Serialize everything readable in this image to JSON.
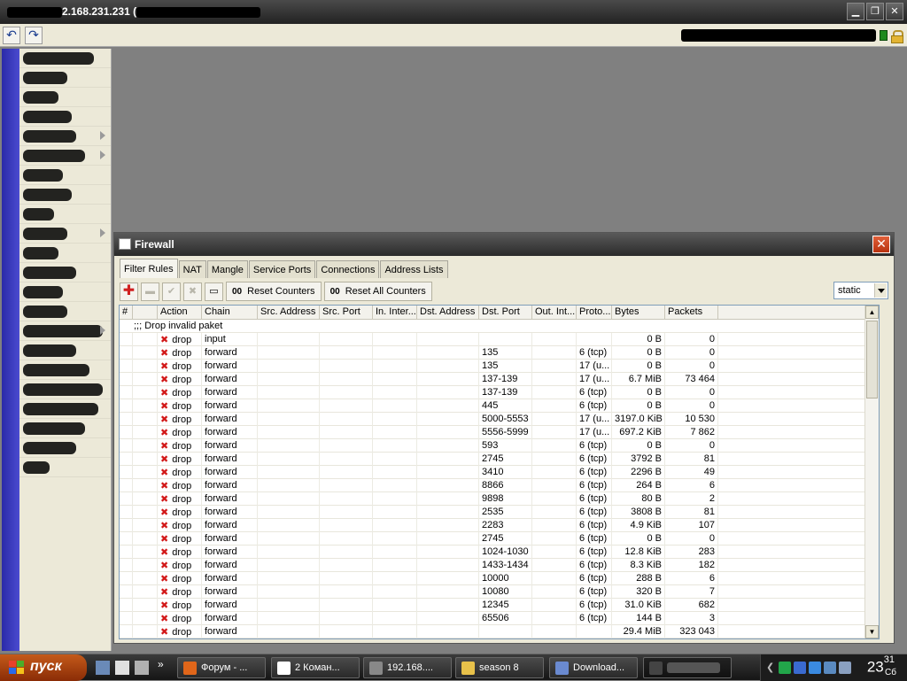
{
  "app": {
    "title_visible": "2.168.231.231 ("
  },
  "firewall": {
    "window_title": "Firewall",
    "tabs": [
      "Filter Rules",
      "NAT",
      "Mangle",
      "Service Ports",
      "Connections",
      "Address Lists"
    ],
    "active_tab": "Filter Rules",
    "reset_counters_label": "Reset Counters",
    "reset_all_counters_label": "Reset All Counters",
    "reset_prefix": "00",
    "filter_value": "static",
    "columns": [
      "#",
      "",
      "Action",
      "Chain",
      "Src. Address",
      "Src. Port",
      "In. Inter...",
      "Dst. Address",
      "Dst. Port",
      "Out. Int...",
      "Proto...",
      "Bytes",
      "Packets"
    ],
    "comment": ";;; Drop invalid paket",
    "rows": [
      {
        "action": "drop",
        "chain": "input",
        "dst_port": "",
        "proto": "",
        "bytes": "0 B",
        "packets": "0"
      },
      {
        "action": "drop",
        "chain": "forward",
        "dst_port": "135",
        "proto": "6 (tcp)",
        "bytes": "0 B",
        "packets": "0"
      },
      {
        "action": "drop",
        "chain": "forward",
        "dst_port": "135",
        "proto": "17 (u...",
        "bytes": "0 B",
        "packets": "0"
      },
      {
        "action": "drop",
        "chain": "forward",
        "dst_port": "137-139",
        "proto": "17 (u...",
        "bytes": "6.7 MiB",
        "packets": "73 464"
      },
      {
        "action": "drop",
        "chain": "forward",
        "dst_port": "137-139",
        "proto": "6 (tcp)",
        "bytes": "0 B",
        "packets": "0"
      },
      {
        "action": "drop",
        "chain": "forward",
        "dst_port": "445",
        "proto": "6 (tcp)",
        "bytes": "0 B",
        "packets": "0"
      },
      {
        "action": "drop",
        "chain": "forward",
        "dst_port": "5000-5553",
        "proto": "17 (u...",
        "bytes": "3197.0 KiB",
        "packets": "10 530"
      },
      {
        "action": "drop",
        "chain": "forward",
        "dst_port": "5556-5999",
        "proto": "17 (u...",
        "bytes": "697.2 KiB",
        "packets": "7 862"
      },
      {
        "action": "drop",
        "chain": "forward",
        "dst_port": "593",
        "proto": "6 (tcp)",
        "bytes": "0 B",
        "packets": "0"
      },
      {
        "action": "drop",
        "chain": "forward",
        "dst_port": "2745",
        "proto": "6 (tcp)",
        "bytes": "3792 B",
        "packets": "81"
      },
      {
        "action": "drop",
        "chain": "forward",
        "dst_port": "3410",
        "proto": "6 (tcp)",
        "bytes": "2296 B",
        "packets": "49"
      },
      {
        "action": "drop",
        "chain": "forward",
        "dst_port": "8866",
        "proto": "6 (tcp)",
        "bytes": "264 B",
        "packets": "6"
      },
      {
        "action": "drop",
        "chain": "forward",
        "dst_port": "9898",
        "proto": "6 (tcp)",
        "bytes": "80 B",
        "packets": "2"
      },
      {
        "action": "drop",
        "chain": "forward",
        "dst_port": "2535",
        "proto": "6 (tcp)",
        "bytes": "3808 B",
        "packets": "81"
      },
      {
        "action": "drop",
        "chain": "forward",
        "dst_port": "2283",
        "proto": "6 (tcp)",
        "bytes": "4.9 KiB",
        "packets": "107"
      },
      {
        "action": "drop",
        "chain": "forward",
        "dst_port": "2745",
        "proto": "6 (tcp)",
        "bytes": "0 B",
        "packets": "0"
      },
      {
        "action": "drop",
        "chain": "forward",
        "dst_port": "1024-1030",
        "proto": "6 (tcp)",
        "bytes": "12.8 KiB",
        "packets": "283"
      },
      {
        "action": "drop",
        "chain": "forward",
        "dst_port": "1433-1434",
        "proto": "6 (tcp)",
        "bytes": "8.3 KiB",
        "packets": "182"
      },
      {
        "action": "drop",
        "chain": "forward",
        "dst_port": "10000",
        "proto": "6 (tcp)",
        "bytes": "288 B",
        "packets": "6"
      },
      {
        "action": "drop",
        "chain": "forward",
        "dst_port": "10080",
        "proto": "6 (tcp)",
        "bytes": "320 B",
        "packets": "7"
      },
      {
        "action": "drop",
        "chain": "forward",
        "dst_port": "12345",
        "proto": "6 (tcp)",
        "bytes": "31.0 KiB",
        "packets": "682"
      },
      {
        "action": "drop",
        "chain": "forward",
        "dst_port": "65506",
        "proto": "6 (tcp)",
        "bytes": "144 B",
        "packets": "3"
      },
      {
        "action": "drop",
        "chain": "forward",
        "dst_port": "",
        "proto": "",
        "bytes": "29.4 MiB",
        "packets": "323 043"
      }
    ]
  },
  "taskbar": {
    "start_label": "пуск",
    "tasks": [
      {
        "label": "Форум - ...",
        "icon": "firefox-icon",
        "color": "#e0661a"
      },
      {
        "label": "2 Коман...",
        "icon": "window-icon",
        "color": "#ffffff"
      },
      {
        "label": "192.168....",
        "icon": "router-icon",
        "color": "#888888"
      },
      {
        "label": "season 8",
        "icon": "folder-icon",
        "color": "#e8c14a"
      },
      {
        "label": "Download...",
        "icon": "download-icon",
        "color": "#6a8ad0"
      }
    ],
    "clock_time": "23",
    "clock_minutes": "31",
    "clock_day": "Сб"
  },
  "colors": {
    "accent_red": "#d21818",
    "side_strip": "#2a2aa8",
    "status_green": "#1d8a1d"
  }
}
